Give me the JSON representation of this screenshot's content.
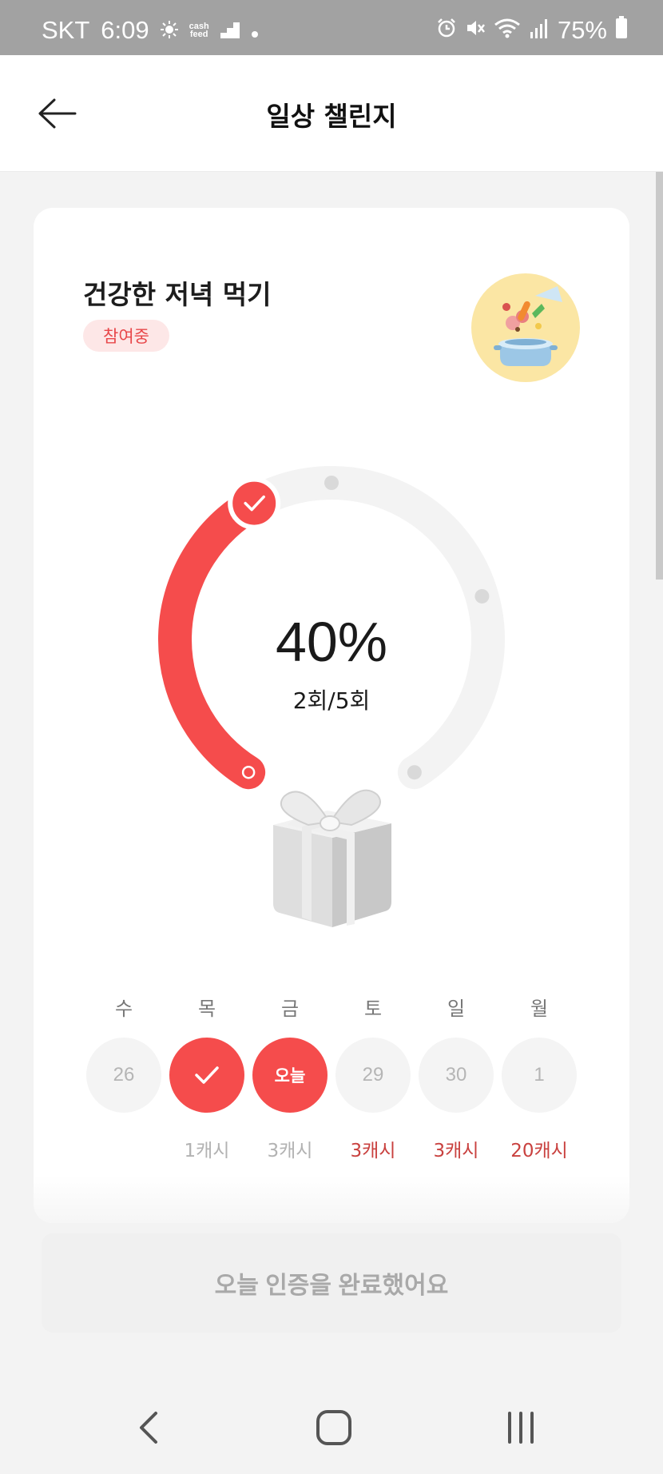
{
  "status_bar": {
    "carrier": "SKT",
    "time": "6:09",
    "cashfeed_line1": "cash",
    "cashfeed_line2": "feed",
    "battery": "75%"
  },
  "header": {
    "title": "일상 챌린지"
  },
  "challenge": {
    "title": "건강한 저녁 먹기",
    "status_badge": "참여중",
    "progress_percent_text": "40%",
    "progress_count_text": "2회/5회",
    "progress_fraction": 0.4,
    "completed": 2,
    "total": 5
  },
  "week": {
    "days": [
      {
        "label": "수",
        "value": "26",
        "state": "past",
        "reward": ""
      },
      {
        "label": "목",
        "value": "",
        "state": "done",
        "reward": "1캐시"
      },
      {
        "label": "금",
        "value": "오늘",
        "state": "today",
        "reward": "3캐시"
      },
      {
        "label": "토",
        "value": "29",
        "state": "future",
        "reward": "3캐시"
      },
      {
        "label": "일",
        "value": "30",
        "state": "future",
        "reward": "3캐시"
      },
      {
        "label": "월",
        "value": "1",
        "state": "future",
        "reward": "20캐시"
      }
    ]
  },
  "action_button": {
    "label": "오늘 인증을 완료했어요"
  },
  "colors": {
    "accent": "#f54c4c",
    "track": "#f3f3f3",
    "badge_bg": "#fde7e7"
  },
  "icons": {
    "back": "arrow-left-icon",
    "nav_back": "chevron-left-icon",
    "nav_home": "rounded-square-icon",
    "nav_recent": "three-bars-icon"
  }
}
